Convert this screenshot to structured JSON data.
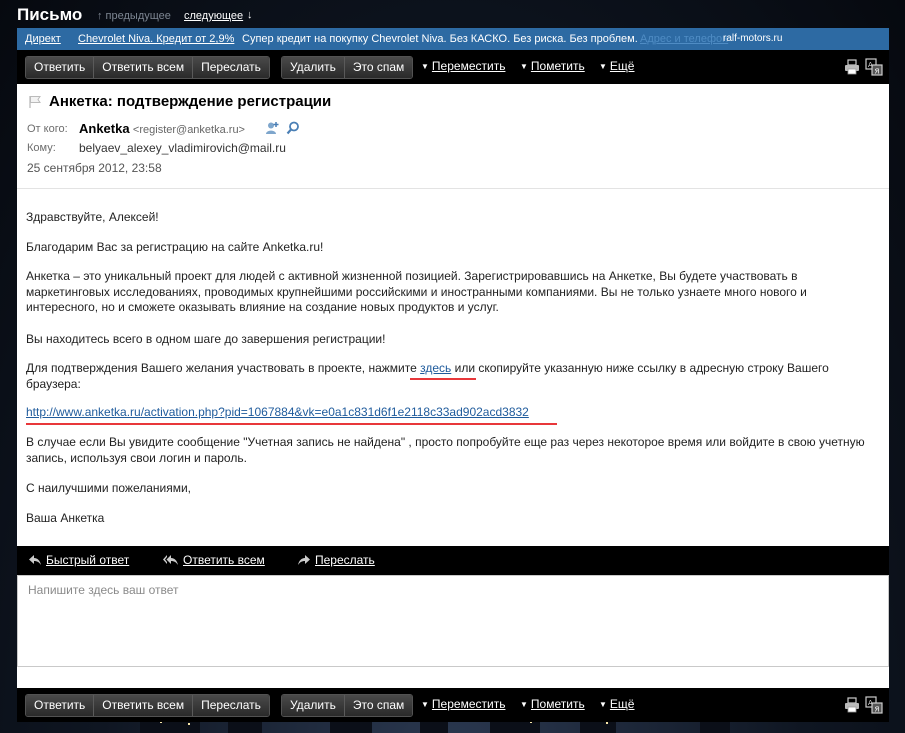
{
  "header": {
    "title": "Письмо",
    "prev_label": "↑ предыдущее",
    "next_label": "следующее",
    "next_arrow": "↓"
  },
  "ad": {
    "direct": "Директ",
    "link_text": "Chevrolet Niva. Кредит от 2,9%",
    "text": "Супер кредит на покупку Chevrolet Niva. Без КАСКО. Без риска. Без проблем.",
    "feedback": "Адрес и телефон",
    "domain": "ralf-motors.ru"
  },
  "toolbar": {
    "reply": "Ответить",
    "reply_all": "Ответить всем",
    "forward": "Переслать",
    "delete": "Удалить",
    "spam": "Это спам",
    "move": "Переместить",
    "mark": "Пометить",
    "more": "Ещё",
    "print_icon": "printer-icon",
    "translate_icon": "translate-icon"
  },
  "message": {
    "subject": "Анкетка: подтверждение регистрации",
    "from_label": "От кого:",
    "from_name": "Anketka",
    "from_email": "<register@anketka.ru>",
    "to_label": "Кому:",
    "to": "belyaev_alexey_vladimirovich@mail.ru",
    "date": "25 сентября 2012, 23:58",
    "greeting": "Здравствуйте, Алексей!",
    "thanks": "Благодарим Вас за регистрацию на сайте Anketka.ru!",
    "about": "Анкетка – это уникальный проект для людей с активной жизненной позицией. Зарегистрировавшись на Анкетке, Вы будете участвовать в маркетинговых исследованиях, проводимых крупнейшими российскими и иностранными компаниями. Вы не только узнаете много нового и интересного, но и сможете оказывать влияние на создание новых продуктов и услуг.",
    "one_step": "Вы находитесь всего в одном шаге до завершения регистрации!",
    "confirm_before": "Для подтверждения Вашего желания участвовать в проекте, нажмите ",
    "confirm_link": "здесь",
    "confirm_after": " или скопируйте указанную ниже ссылку в адресную строку Вашего браузера:",
    "activation_url": "http://www.anketka.ru/activation.php?pid=1067884&vk=e0a1c831d6f1e2118c33ad902acd3832",
    "not_found": "В случае если Вы увидите сообщение \"Учетная запись не найдена\" , просто попробуйте еще раз через некоторое время или войдите в свою учетную запись, используя свои логин и пароль.",
    "regards": "С наилучшими пожеланиями,",
    "signature": "Ваша Анкетка"
  },
  "quick_reply": {
    "quick": "Быстрый ответ",
    "reply_all": "Ответить всем",
    "forward": "Переслать",
    "placeholder": "Напишите здесь ваш ответ"
  },
  "colors": {
    "ad_bar": "#2d6aa3",
    "link": "#1f5b9c",
    "highlight_underline": "#e8373a"
  }
}
